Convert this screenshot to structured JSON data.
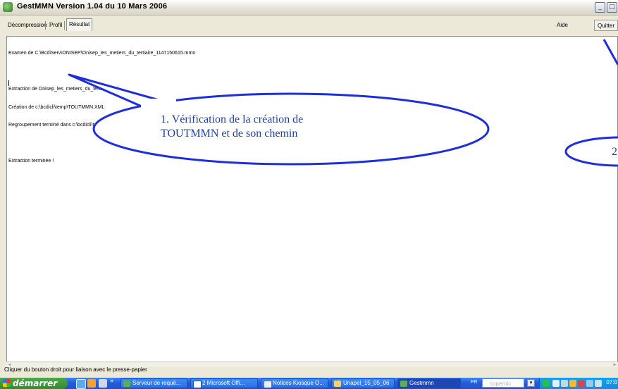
{
  "window": {
    "title": "GestMMN  Version 1.04 du 10 Mars 2006",
    "minimize_glyph": "_",
    "maximize_glyph": "□"
  },
  "tabs": [
    {
      "label": "Décompression",
      "active": false
    },
    {
      "label": "Profil",
      "active": false
    },
    {
      "label": "Résultat",
      "active": true
    }
  ],
  "toolbar": {
    "aide_label": "Aide",
    "quitter_label": "Quitter"
  },
  "log_lines": [
    "Examen de C:\\BcdiServ\\ONISEP\\Onisep_les_metiers_du_tertiaire_1147150615.mmn",
    "",
    "Extraction de Onisep_les_metiers_du_tertiaire.xml",
    "Création de c:\\bcdicli\\temp\\TOUTMMN.XML",
    "Regroupement terminé dans c:\\bcdicli\\temp\\TOUTMMN.XML",
    "",
    "Extraction terminée !"
  ],
  "status_bar": {
    "text": "Cliquer du bouton droit pour liaison avec le presse-papier"
  },
  "callouts": [
    {
      "line1": "1. Vérification de la création de",
      "line2": "TOUTMMN et de son chemin"
    },
    {
      "line1": "2"
    }
  ],
  "taskbar": {
    "start_label": "démarrer",
    "quicklaunch_more": "»",
    "tasks": [
      {
        "label": "Serveur de requê...",
        "active": false
      },
      {
        "label": "2 Microsoft Offi...",
        "active": false
      },
      {
        "label": "Notices Kiosque O...",
        "active": false
      },
      {
        "label": "Unapel_15_05_06",
        "active": false
      },
      {
        "label": "Gestmmn",
        "active": true
      }
    ],
    "language": "FR",
    "search_placeholder": "copernic",
    "clock": "07:0"
  },
  "colors": {
    "callout_stroke": "#1f2fd8",
    "callout_text": "#1e3ea8",
    "taskbar": "#245ddb",
    "start_green": "#3a9a35"
  }
}
